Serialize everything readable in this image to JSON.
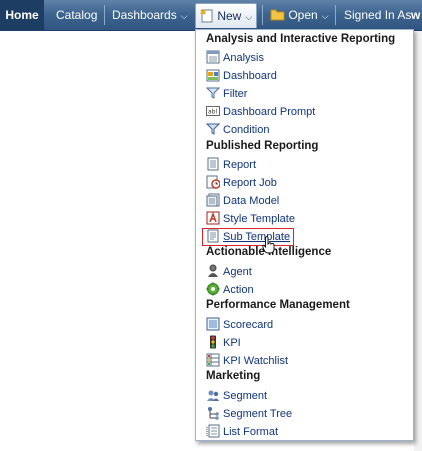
{
  "navbar": {
    "home": "Home",
    "catalog": "Catalog",
    "dashboards": "Dashboards",
    "new": "New",
    "open": "Open",
    "signed_in_as": "Signed In As",
    "user_initial": "w"
  },
  "menu": {
    "sections": [
      {
        "title": "Analysis and Interactive Reporting",
        "items": [
          {
            "label": "Analysis",
            "icon": "analysis-icon"
          },
          {
            "label": "Dashboard",
            "icon": "dashboard-icon"
          },
          {
            "label": "Filter",
            "icon": "filter-icon"
          },
          {
            "label": "Dashboard Prompt",
            "icon": "dashboard-prompt-icon"
          },
          {
            "label": "Condition",
            "icon": "condition-icon"
          }
        ]
      },
      {
        "title": "Published Reporting",
        "items": [
          {
            "label": "Report",
            "icon": "report-icon"
          },
          {
            "label": "Report Job",
            "icon": "report-job-icon"
          },
          {
            "label": "Data Model",
            "icon": "data-model-icon"
          },
          {
            "label": "Style Template",
            "icon": "style-template-icon"
          },
          {
            "label": "Sub Template",
            "icon": "sub-template-icon"
          }
        ]
      },
      {
        "title": "Actionable Intelligence",
        "items": [
          {
            "label": "Agent",
            "icon": "agent-icon"
          },
          {
            "label": "Action",
            "icon": "action-icon"
          }
        ]
      },
      {
        "title": "Performance Management",
        "items": [
          {
            "label": "Scorecard",
            "icon": "scorecard-icon"
          },
          {
            "label": "KPI",
            "icon": "kpi-icon"
          },
          {
            "label": "KPI Watchlist",
            "icon": "kpi-watchlist-icon"
          }
        ]
      },
      {
        "title": "Marketing",
        "items": [
          {
            "label": "Segment",
            "icon": "segment-icon"
          },
          {
            "label": "Segment Tree",
            "icon": "segment-tree-icon"
          },
          {
            "label": "List Format",
            "icon": "list-format-icon"
          }
        ]
      }
    ],
    "hovered_item": "Sub Template"
  },
  "colors": {
    "nav_bg": "#3e6590",
    "home_bg": "#1e3d63",
    "menu_text": "#10357a",
    "hover_border": "#d9262b"
  }
}
